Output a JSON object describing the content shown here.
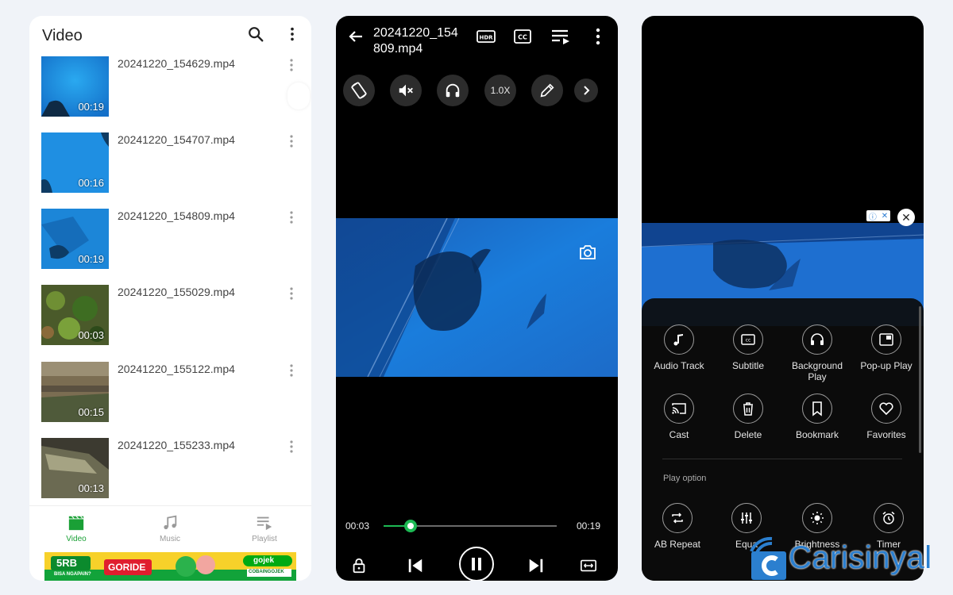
{
  "list_screen": {
    "title": "Video",
    "videos": [
      {
        "filename": "20241220_154629.mp4",
        "duration": "00:19"
      },
      {
        "filename": "20241220_154707.mp4",
        "duration": "00:16"
      },
      {
        "filename": "20241220_154809.mp4",
        "duration": "00:19"
      },
      {
        "filename": "20241220_155029.mp4",
        "duration": "00:03"
      },
      {
        "filename": "20241220_155122.mp4",
        "duration": "00:15"
      },
      {
        "filename": "20241220_155233.mp4",
        "duration": "00:13"
      }
    ],
    "tabs": [
      {
        "label": "Video",
        "icon": "video-icon",
        "active": true
      },
      {
        "label": "Music",
        "icon": "music-note-icon",
        "active": false
      },
      {
        "label": "Playlist",
        "icon": "playlist-icon",
        "active": false
      }
    ],
    "ad": {
      "badge": "5RB",
      "sub": "BISA NGAPAIN?",
      "cta": "GORIDE",
      "brand": "gojek",
      "code": "COBAINGOJEK"
    }
  },
  "player_screen": {
    "title": "20241220_154809.mp4",
    "title_lines": [
      "20241220_154",
      "809.mp4"
    ],
    "top_icons": [
      "back-arrow-icon",
      "hdr-icon",
      "cc-icon",
      "playlist-queue-icon",
      "more-vert-icon"
    ],
    "controls": [
      {
        "icon": "rotate-screen-icon",
        "label": ""
      },
      {
        "icon": "mute-icon",
        "label": ""
      },
      {
        "icon": "headphones-icon",
        "label": ""
      },
      {
        "icon": "speed-icon",
        "label": "1.0X"
      },
      {
        "icon": "edit-pencil-icon",
        "label": ""
      },
      {
        "icon": "chevron-right-icon",
        "label": ""
      }
    ],
    "current_time": "00:03",
    "total_time": "00:19",
    "progress_fraction": 0.158,
    "bottom_icons": [
      "lock-icon",
      "previous-icon",
      "pause-icon",
      "next-icon",
      "aspect-ratio-icon"
    ]
  },
  "menu_screen": {
    "items": [
      {
        "label": "Audio Track",
        "icon": "music-note-icon"
      },
      {
        "label": "Subtitle",
        "icon": "cc-icon"
      },
      {
        "label": "Background Play",
        "icon": "headphones-icon"
      },
      {
        "label": "Pop-up Play",
        "icon": "popup-play-icon"
      },
      {
        "label": "Cast",
        "icon": "cast-icon"
      },
      {
        "label": "Delete",
        "icon": "trash-icon"
      },
      {
        "label": "Bookmark",
        "icon": "bookmark-icon"
      },
      {
        "label": "Favorites",
        "icon": "heart-icon"
      }
    ],
    "section_title": "Play option",
    "play_options": [
      {
        "label": "AB Repeat",
        "icon": "ab-repeat-icon"
      },
      {
        "label": "Equa",
        "icon": "equalizer-icon"
      },
      {
        "label": "Brightness",
        "icon": "brightness-icon"
      },
      {
        "label": "Timer",
        "icon": "alarm-icon"
      }
    ]
  },
  "watermark": {
    "text": "Carisinyal"
  },
  "colors": {
    "accent_green": "#1aa036",
    "player_green": "#1db954",
    "watermark_blue": "#2b7fcf"
  }
}
